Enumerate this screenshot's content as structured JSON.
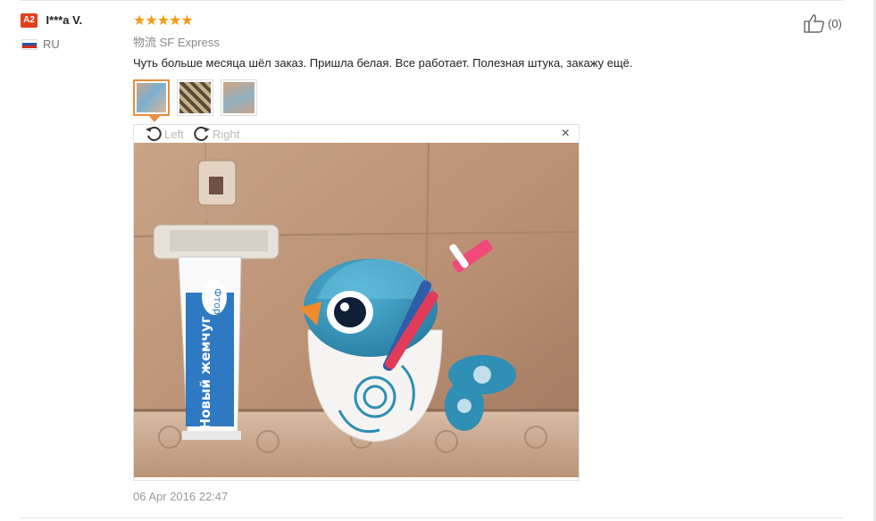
{
  "review": {
    "user": {
      "level_badge": "A2",
      "name": "I***a V.",
      "country": "RU"
    },
    "rating": {
      "stars": 5,
      "stars_text": "★★★★★"
    },
    "shipping": {
      "label": "物流",
      "method": "SF Express"
    },
    "text": "Чуть больше месяца шёл заказ. Пришла белая. Все работает. Полезная штука, закажу ещё.",
    "thumbnails": [
      {
        "name": "photo-1",
        "active": true
      },
      {
        "name": "photo-2",
        "active": false
      },
      {
        "name": "photo-3",
        "active": false
      }
    ],
    "viewer": {
      "rotate_left_label": "Left",
      "rotate_right_label": "Right",
      "close_glyph": "×"
    },
    "photo_text": {
      "toothpaste_brand": "Новый жемчуг",
      "toothpaste_flavor": "Фтор"
    },
    "date": "06 Apr 2016 22:47",
    "helpful": {
      "count_text": "(0)"
    }
  },
  "colors": {
    "accent": "#e88e3e",
    "star": "#f39c12",
    "badge": "#e0401e",
    "bird": "#2f8fb4"
  }
}
